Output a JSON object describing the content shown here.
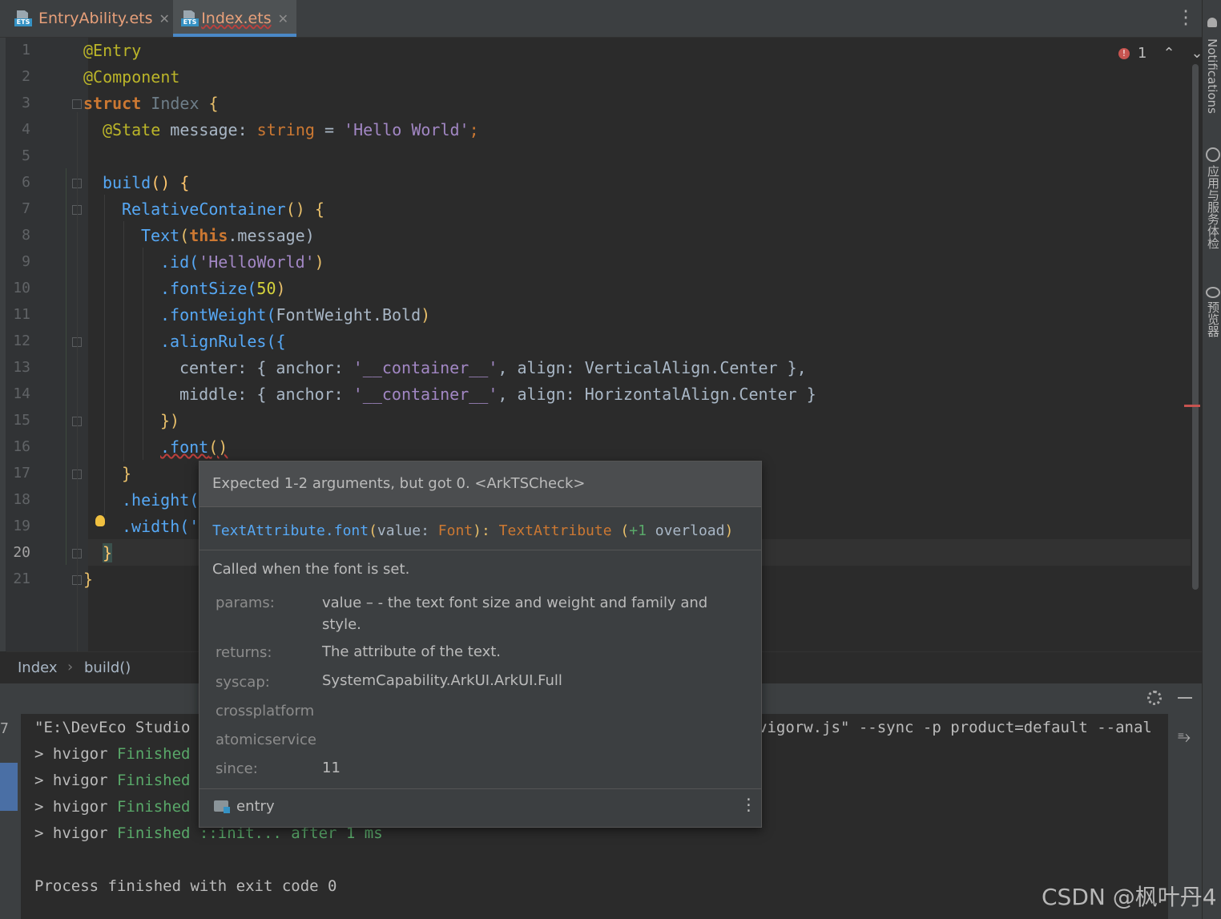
{
  "tabs": [
    {
      "label": "EntryAbility.ets",
      "icon": "ets-file-icon"
    },
    {
      "label": "Index.ets",
      "icon": "ets-file-icon"
    }
  ],
  "right_panels": [
    "Notifications",
    "应用与服务体检",
    "预览器"
  ],
  "inspection": {
    "error_count": "1"
  },
  "line_numbers": [
    "1",
    "2",
    "3",
    "4",
    "5",
    "6",
    "7",
    "8",
    "9",
    "10",
    "11",
    "12",
    "13",
    "14",
    "15",
    "16",
    "17",
    "18",
    "19",
    "20",
    "21"
  ],
  "code": {
    "l1": "@Entry",
    "l2": "@Component",
    "l3_kw": "struct",
    "l3_name": "Index",
    "l3_brace": " {",
    "l4_anno": "@State",
    "l4_var": " message: ",
    "l4_type": "string",
    "l4_eq": " = ",
    "l4_str": "'Hello World'",
    "l4_end": ";",
    "l6_fn": "build",
    "l6_rest": "() {",
    "l7_cls": "RelativeContainer",
    "l7_rest": "() {",
    "l8_cls": "Text",
    "l8_this": "this",
    "l8_rest": ".message)",
    "l9_fn": ".id(",
    "l9_str": "'HelloWorld'",
    "l9_end": ")",
    "l10_fn": ".fontSize(",
    "l10_num": "50",
    "l10_end": ")",
    "l11_fn": ".fontWeight(",
    "l11_arg": "FontWeight.Bold",
    "l11_end": ")",
    "l12_fn": ".alignRules({",
    "l13_a": "center: { anchor: ",
    "l13_str": "'__container__'",
    "l13_b": ", align: VerticalAlign.Center },",
    "l14_a": "middle: { anchor: ",
    "l14_str": "'__container__'",
    "l14_b": ", align: HorizontalAlign.Center }",
    "l15": "})",
    "l16_fn": ".font",
    "l16_rest": "()",
    "l17": "}",
    "l18": ".height(",
    "l19": ".width('",
    "l20": "}",
    "l21": "}"
  },
  "breadcrumb": {
    "item1": "Index",
    "sep": "›",
    "item2": "build()"
  },
  "run": {
    "line1_left": "\"E:\\DevEco Studio",
    "line1_right": "vigorw.js\" --sync -p product=default --anal",
    "hvigor_lines": [
      {
        "prefix": "> hvigor ",
        "status": "Finished"
      },
      {
        "prefix": "> hvigor ",
        "status": "Finished"
      },
      {
        "prefix": "> hvigor ",
        "status": "Finished"
      },
      {
        "prefix": "> hvigor ",
        "status": "Finished",
        "task": " ::init... after 1 ms"
      }
    ],
    "exit_message": "Process finished with exit code 0",
    "left_num": "7"
  },
  "popup": {
    "error": "Expected 1-2 arguments, but got 0. <ArkTSCheck>",
    "sig_owner": "TextAttribute",
    "sig_fn": ".font",
    "sig_open": "(",
    "sig_param": "value: ",
    "sig_ptype": "Font",
    "sig_close": "): ",
    "sig_ret": "TextAttribute",
    "sig_overload_open": " (",
    "sig_overload_num": "+1",
    "sig_overload_word": " overload",
    "sig_overload_close": ")",
    "description": "Called when the font is set.",
    "params_label": "params:",
    "params_value": "value – - the text font size and weight and family and style.",
    "returns_label": "returns:",
    "returns_value": "The attribute of the text.",
    "syscap_label": "syscap:",
    "syscap_value": "SystemCapability.ArkUI.ArkUI.Full",
    "crossplatform_label": "crossplatform",
    "atomicservice_label": "atomicservice",
    "since_label": "since:",
    "since_value": "11",
    "module": "entry"
  },
  "watermark": "CSDN @枫叶丹4"
}
